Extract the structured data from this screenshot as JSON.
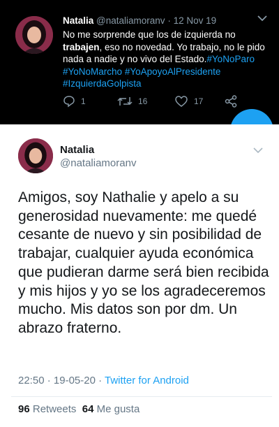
{
  "tweet_top": {
    "name": "Natalia",
    "handle": "@nataliamoranv",
    "separator": "·",
    "date": "12 Nov 19",
    "text_part1": "No me sorprende que los de izquierda no ",
    "text_bold": "trabajen",
    "text_part2": ", eso no novedad. Yo trabajo, no le pido nada a nadie y no vivo del Estado.",
    "hashtags": [
      "#YoNoParo",
      "#YoNoMarcho",
      "#YoApoyoAlPresidente",
      "#IzquierdaGolpista"
    ],
    "replies": "1",
    "retweets": "16",
    "likes": "17"
  },
  "tweet_main": {
    "name": "Natalia",
    "handle": "@nataliamoranv",
    "text": "Amigos, soy Nathalie y apelo a su generosidad nuevamente: me quedé cesante de nuevo y sin posibilidad de trabajar, cualquier ayuda económica que pudieran darme será bien recibida y mis hijos y yo se los agradeceremos mucho. Mis datos son por dm. Un abrazo fraterno.",
    "time": "22:50",
    "separator": "·",
    "date": "19-05-20",
    "separator2": "·",
    "source": "Twitter for Android",
    "retweet_count": "96",
    "retweet_label": "Retweets",
    "like_count": "64",
    "like_label": "Me gusta"
  },
  "colors": {
    "dark_bg": "#000000",
    "link": "#1da1f2",
    "muted_dark": "#8899a6",
    "muted_light": "#657786"
  },
  "icons": [
    "reply-icon",
    "retweet-icon",
    "like-icon",
    "share-icon",
    "chevron-down-icon",
    "compose-fab"
  ]
}
